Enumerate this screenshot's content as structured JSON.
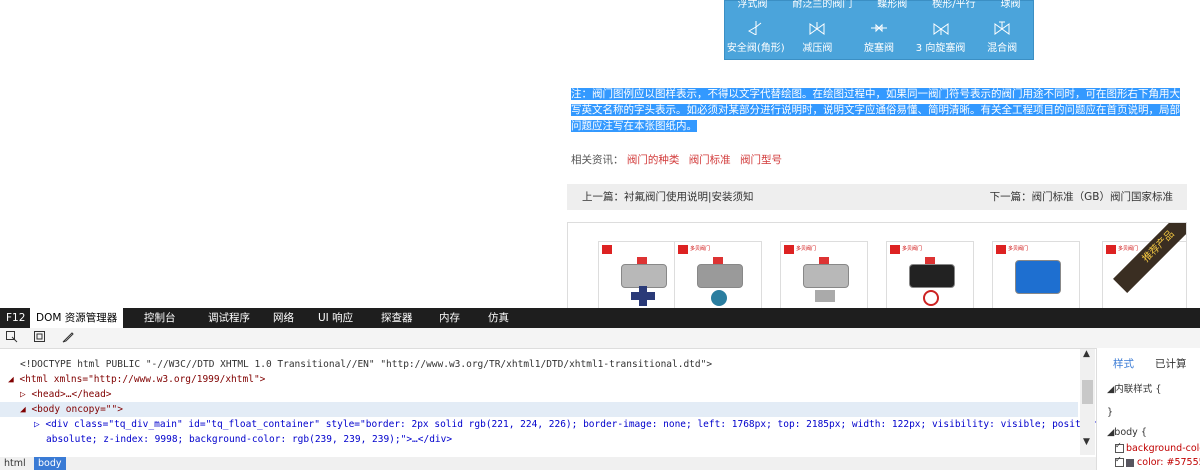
{
  "valve_panel": {
    "top_labels": [
      "浮式阀",
      "耐泛兰的阀门",
      "蝶形阀",
      "楔形/平行",
      "球阀"
    ],
    "items": [
      {
        "label": "安全阀(角形)",
        "icon": "safety-valve-angle-icon"
      },
      {
        "label": "减压阀",
        "icon": "pressure-reducing-valve-icon"
      },
      {
        "label": "旋塞阀",
        "icon": "plug-valve-icon"
      },
      {
        "label": "3 向旋塞阀",
        "icon": "three-way-plug-valve-icon"
      },
      {
        "label": "混合阀",
        "icon": "mixing-valve-icon"
      }
    ]
  },
  "note": {
    "text": "注：阀门图例应以图样表示，不得以文字代替绘图。在绘图过程中，如果同一阀门符号表示的阀门用途不同时，可在图形右下角用大写英文名称的字头表示。如必须对某部分进行说明时，说明文字应通俗易懂、简明清晰。有关全工程项目的问题应在首页说明，局部问题应注写在本张图纸内。"
  },
  "related": {
    "label": "相关资讯：",
    "links": [
      "阀门的种类",
      "阀门标准",
      "阀门型号"
    ]
  },
  "prevnext": {
    "prev": "上一篇：衬氟阀门使用说明|安装须知",
    "next": "下一篇：阀门标准（GB）阀门国家标准"
  },
  "products": {
    "ribbon": "推荐产品",
    "brand": "多贝阀门",
    "count": 6
  },
  "devtools": {
    "menu": [
      "F12",
      "DOM 资源管理器",
      "控制台",
      "调试程序",
      "网络",
      "UI 响应",
      "探查器",
      "内存",
      "仿真"
    ],
    "active_menu": "DOM 资源管理器",
    "toolbar_icons": [
      "select-element-icon",
      "highlight-box-icon",
      "edit-pen-icon"
    ],
    "dom_lines": [
      "<!DOCTYPE html PUBLIC \"-//W3C//DTD XHTML 1.0 Transitional//EN\" \"http://www.w3.org/TR/xhtml1/DTD/xhtml1-transitional.dtd\">",
      "◢ <html xmlns=\"http://www.w3.org/1999/xhtml\">",
      "▷ <head>…</head>",
      "◢ <body oncopy=\"\">",
      "▷ <div class=\"tq_div_main\" id=\"tq_float_container\" style=\"border: 2px solid rgb(221, 224, 226); border-image: none; left: 1768px; top: 2185px; width: 122px; visibility: visible; position:",
      "absolute; z-index: 9998; background-color: rgb(239, 239, 239);\">…</div>"
    ],
    "styles_tabs": [
      "样式",
      "已计算"
    ],
    "styles_lines": [
      "◢内联样式  {",
      "}",
      "◢body  {",
      "background-colo",
      "color:  #57555"
    ],
    "breadcrumb": [
      "html",
      "body"
    ],
    "colors": {
      "menu_bg": "#1e1e1e",
      "selected_row": "#e3ecf6",
      "tag": "#800000",
      "attr": "#c00000",
      "value": "#0000cc",
      "accent": "#3a7bd5"
    }
  }
}
